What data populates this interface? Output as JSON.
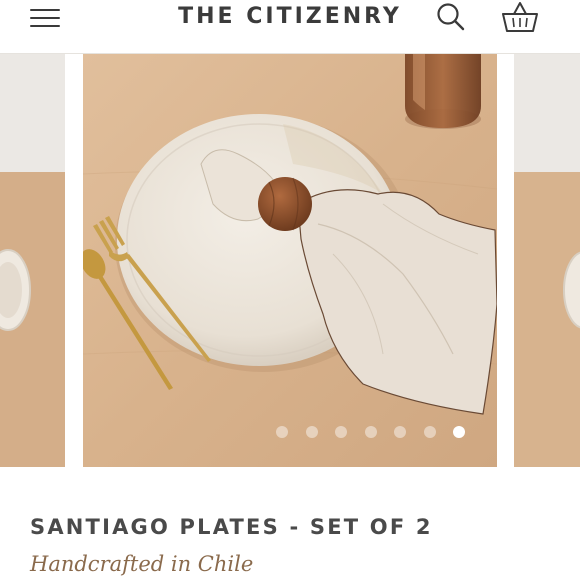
{
  "header": {
    "brand": "THE CITIZENRY",
    "menu_icon": "hamburger-menu-icon",
    "search_icon": "search-icon",
    "cart_icon": "basket-icon"
  },
  "carousel": {
    "slide_count": 7,
    "active_index": 6,
    "main_image": "plate-with-napkin-and-gold-cutlery",
    "colors": {
      "table": "#d9b48f",
      "plate": "#ede6dc",
      "napkin": "#e7ddd3",
      "gold": "#c9a14e"
    }
  },
  "product": {
    "title": "SANTIAGO PLATES - SET OF 2",
    "subtitle": "Handcrafted in Chile"
  },
  "colors": {
    "brand_text": "#3b3b3b",
    "title_text": "#4a4a4a",
    "subtitle_text": "#8a6a4c"
  }
}
